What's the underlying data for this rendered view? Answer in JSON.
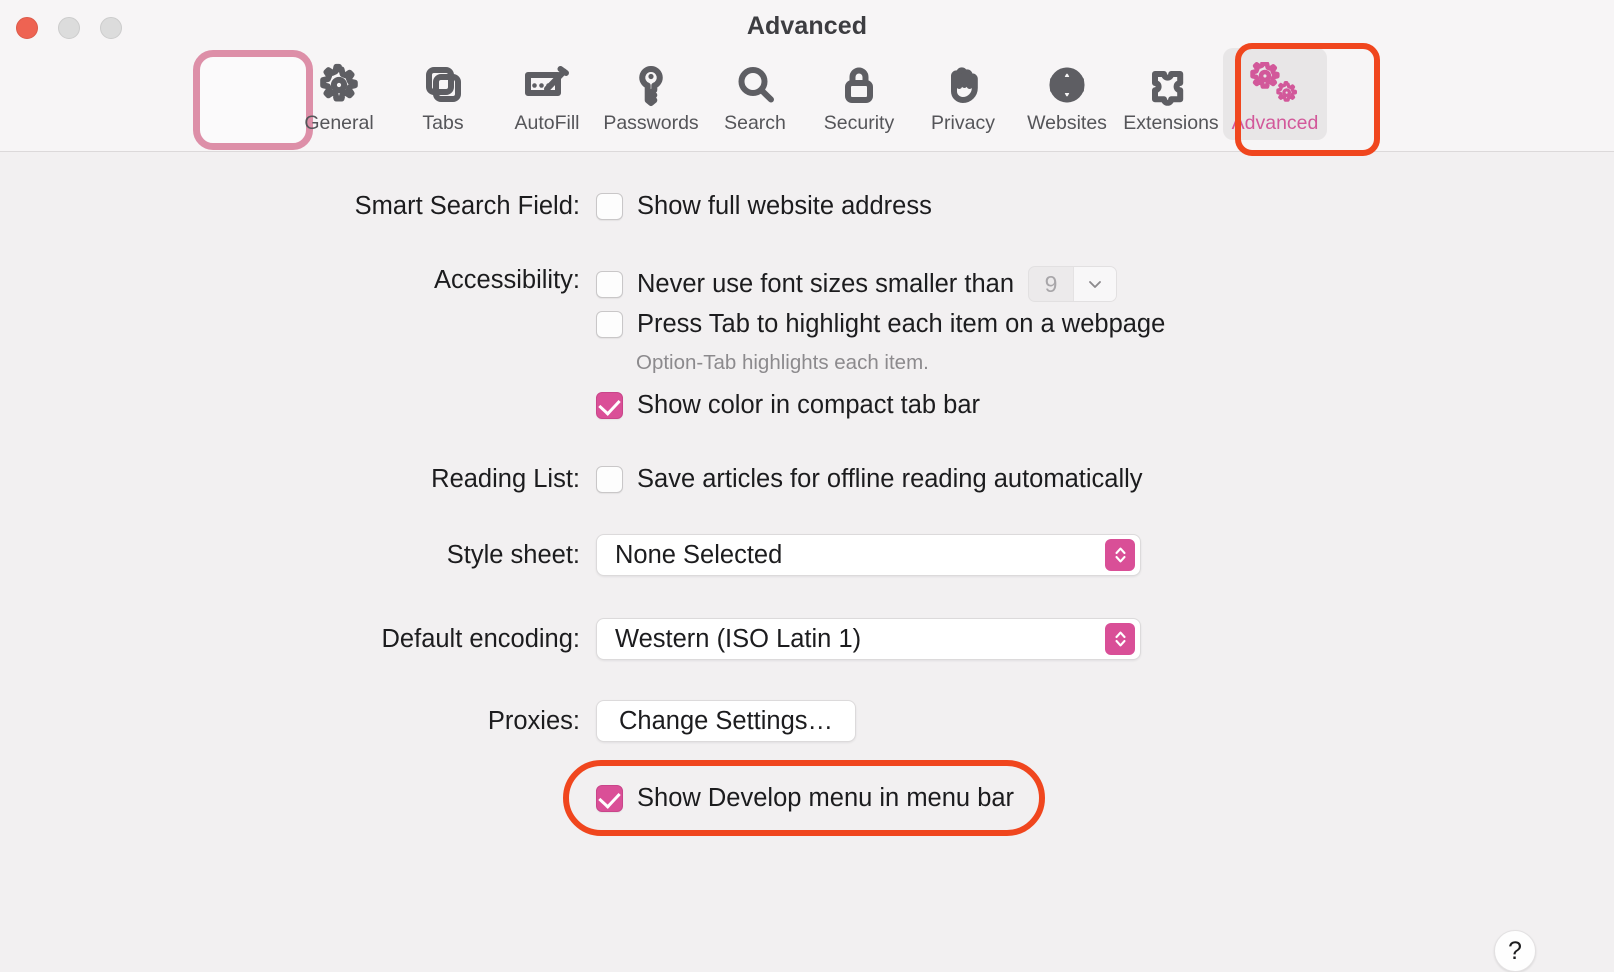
{
  "window": {
    "title": "Advanced",
    "traffic_lights": [
      "close",
      "minimize",
      "maximize"
    ]
  },
  "toolbar": {
    "tabs": [
      {
        "label": "General",
        "icon": "gear-icon",
        "selected": false
      },
      {
        "label": "Tabs",
        "icon": "tabs-icon",
        "selected": false
      },
      {
        "label": "AutoFill",
        "icon": "autofill-icon",
        "selected": false
      },
      {
        "label": "Passwords",
        "icon": "key-icon",
        "selected": false
      },
      {
        "label": "Search",
        "icon": "search-icon",
        "selected": false
      },
      {
        "label": "Security",
        "icon": "lock-icon",
        "selected": false
      },
      {
        "label": "Privacy",
        "icon": "hand-icon",
        "selected": false
      },
      {
        "label": "Websites",
        "icon": "globe-icon",
        "selected": false
      },
      {
        "label": "Extensions",
        "icon": "puzzle-icon",
        "selected": false
      },
      {
        "label": "Advanced",
        "icon": "double-gear-icon",
        "selected": true
      }
    ]
  },
  "annotations": {
    "general_highlight_color": "#dd8fa8",
    "advanced_highlight_color": "#f0461e",
    "develop_highlight_color": "#f0461e"
  },
  "colors": {
    "accent_pink": "#da4f97",
    "window_background": "#f2f0f1",
    "titlebar_background": "#f7f5f6"
  },
  "settings": {
    "smart_search_field": {
      "label": "Smart Search Field:",
      "checkbox_label": "Show full website address",
      "checked": false
    },
    "accessibility": {
      "label": "Accessibility:",
      "min_font": {
        "checkbox_label": "Never use font sizes smaller than",
        "checked": false,
        "value": "9"
      },
      "press_tab": {
        "checkbox_label": "Press Tab to highlight each item on a webpage",
        "checked": false
      },
      "hint": "Option-Tab highlights each item.",
      "compact_tab_color": {
        "checkbox_label": "Show color in compact tab bar",
        "checked": true
      }
    },
    "reading_list": {
      "label": "Reading List:",
      "checkbox_label": "Save articles for offline reading automatically",
      "checked": false
    },
    "style_sheet": {
      "label": "Style sheet:",
      "value": "None Selected"
    },
    "default_encoding": {
      "label": "Default encoding:",
      "value": "Western (ISO Latin 1)"
    },
    "proxies": {
      "label": "Proxies:",
      "button_label": "Change Settings…"
    },
    "develop_menu": {
      "checkbox_label": "Show Develop menu in menu bar",
      "checked": true
    }
  },
  "help": {
    "glyph": "?"
  }
}
